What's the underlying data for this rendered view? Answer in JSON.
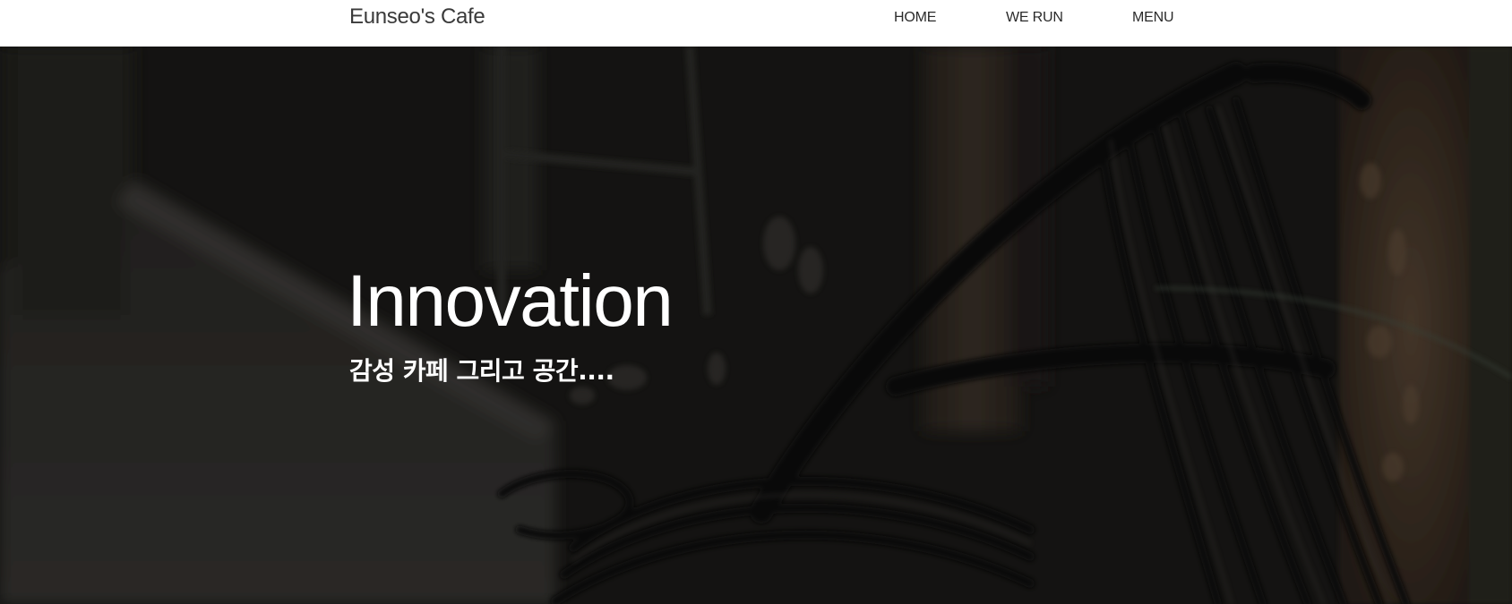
{
  "navbar": {
    "brand": "Eunseo's Cafe",
    "links": [
      {
        "label": "HOME"
      },
      {
        "label": "WE RUN"
      },
      {
        "label": "MENU"
      }
    ]
  },
  "hero": {
    "title": "Innovation",
    "subtitle": "감성 카페 그리고 공간....",
    "background_image": "dark blurred cafe interior with rattan chair"
  },
  "colors": {
    "navbar_bg": "#ffffff",
    "nav_text": "#2a2a2a",
    "brand_text": "#3a3a3a",
    "hero_text": "#ffffff",
    "hero_bg": "#1d1c1a"
  }
}
